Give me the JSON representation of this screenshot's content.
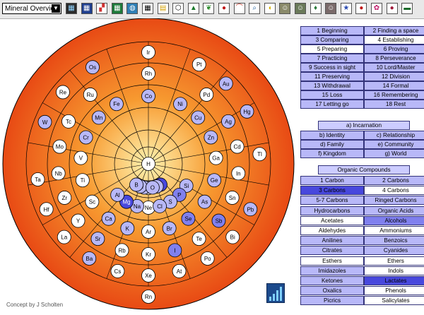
{
  "toolbar": {
    "dropdown_value": "Mineral Overview",
    "icons": [
      {
        "name": "grid-dark-icon",
        "bg": "#2b2b2b",
        "fg": "#8fd4ff",
        "g": "▦"
      },
      {
        "name": "grid-blue-icon",
        "bg": "#1f3f8f",
        "fg": "#ffffff",
        "g": "▦"
      },
      {
        "name": "color-squares-icon",
        "bg": "#ffffff",
        "fg": "#d03030",
        "g": "▞"
      },
      {
        "name": "grid-green-icon",
        "bg": "#1d7a3a",
        "fg": "#ffffff",
        "g": "▦"
      },
      {
        "name": "globe-icon",
        "bg": "#2f7fb5",
        "fg": "#ffffff",
        "g": "◍"
      },
      {
        "name": "table-grid-icon",
        "bg": "#ffffff",
        "fg": "#000000",
        "g": "▦"
      },
      {
        "name": "blocks-icon",
        "bg": "#ffffff",
        "fg": "#d4a000",
        "g": "▤"
      },
      {
        "name": "hexagon-icon",
        "bg": "#ffffff",
        "fg": "#000000",
        "g": "⬡"
      },
      {
        "name": "pine-tree-icon",
        "bg": "#ffffff",
        "fg": "#1a7a2a",
        "g": "▲"
      },
      {
        "name": "leaf-icon",
        "bg": "#ffffff",
        "fg": "#2a8a2a",
        "g": "❦"
      },
      {
        "name": "cherries-icon",
        "bg": "#ffffff",
        "fg": "#c01a1a",
        "g": "●"
      },
      {
        "name": "mushroom-icon",
        "bg": "#ffffff",
        "fg": "#c83a2a",
        "g": "⌒"
      },
      {
        "name": "magnifier-icon",
        "bg": "#ffffff",
        "fg": "#1a5a9a",
        "g": "⌕"
      },
      {
        "name": "duck-icon",
        "bg": "#ffffff",
        "fg": "#d4b000",
        "g": "◖"
      },
      {
        "name": "portrait-a-icon",
        "bg": "#8a8a6a",
        "fg": "#ffffff",
        "g": "☺"
      },
      {
        "name": "portrait-b-icon",
        "bg": "#6a7a5a",
        "fg": "#ffffff",
        "g": "☺"
      },
      {
        "name": "drop-icon",
        "bg": "#ffffff",
        "fg": "#2a7a3a",
        "g": "♦"
      },
      {
        "name": "portrait-c-icon",
        "bg": "#7a6a6a",
        "fg": "#ffffff",
        "g": "☺"
      },
      {
        "name": "star-icon",
        "bg": "#ffffff",
        "fg": "#2a4ab0",
        "g": "★"
      },
      {
        "name": "apple-icon",
        "bg": "#ffffff",
        "fg": "#c01a1a",
        "g": "●"
      },
      {
        "name": "flower-icon",
        "bg": "#ffffff",
        "fg": "#c01a6a",
        "g": "✿"
      },
      {
        "name": "berry-icon",
        "bg": "#ffffff",
        "fg": "#a01a3a",
        "g": "●"
      },
      {
        "name": "car-icon",
        "bg": "#ffffff",
        "fg": "#1a6a2a",
        "g": "▬"
      }
    ]
  },
  "wheel": {
    "colors": {
      "outer": "#e84a14",
      "mid": "#f79a30",
      "center": "#fff3b0",
      "ring_line": "#000000",
      "chip_white": "#ffffff",
      "chip_light": "#b8b8f8",
      "chip_mid": "#8080ee",
      "chip_dark": "#4848dd"
    },
    "elements": [
      {
        "s": "H",
        "r": 0,
        "a": 0,
        "t": "w"
      },
      {
        "s": "He",
        "r": 1,
        "a": 0,
        "t": "w"
      },
      {
        "s": "Li",
        "r": 1,
        "a": 10,
        "t": "l"
      },
      {
        "s": "Be",
        "r": 1,
        "a": 20,
        "t": "l"
      },
      {
        "s": "B",
        "r": 1,
        "a": 30,
        "t": "l"
      },
      {
        "s": "C",
        "r": 1,
        "a": 330,
        "t": "d"
      },
      {
        "s": "N",
        "r": 1,
        "a": 340,
        "t": "l"
      },
      {
        "s": "O",
        "r": 1,
        "a": 350,
        "t": "l"
      },
      {
        "s": "Ne",
        "r": 2,
        "a": 0,
        "t": "w"
      },
      {
        "s": "Na",
        "r": 2,
        "a": 15,
        "t": "l"
      },
      {
        "s": "Mg",
        "r": 2,
        "a": 30,
        "t": "d"
      },
      {
        "s": "Al",
        "r": 2,
        "a": 45,
        "t": "l"
      },
      {
        "s": "Si",
        "r": 2,
        "a": 300,
        "t": "l"
      },
      {
        "s": "P",
        "r": 2,
        "a": 315,
        "t": "m"
      },
      {
        "s": "S",
        "r": 2,
        "a": 330,
        "t": "l"
      },
      {
        "s": "Cl",
        "r": 2,
        "a": 345,
        "t": "l"
      },
      {
        "s": "Ar",
        "r": 3,
        "a": 0,
        "t": "w"
      },
      {
        "s": "K",
        "r": 3,
        "a": 18,
        "t": "l"
      },
      {
        "s": "Ca",
        "r": 3,
        "a": 36,
        "t": "l"
      },
      {
        "s": "Sc",
        "r": 3,
        "a": 56,
        "t": "w"
      },
      {
        "s": "Ti",
        "r": 3,
        "a": 76,
        "t": "w"
      },
      {
        "s": "V",
        "r": 3,
        "a": 95,
        "t": "w"
      },
      {
        "s": "Cr",
        "r": 3,
        "a": 113,
        "t": "l"
      },
      {
        "s": "Mn",
        "r": 3,
        "a": 133,
        "t": "l"
      },
      {
        "s": "Fe",
        "r": 3,
        "a": 152,
        "t": "l"
      },
      {
        "s": "Co",
        "r": 3,
        "a": 180,
        "t": "l"
      },
      {
        "s": "Ni",
        "r": 3,
        "a": 208,
        "t": "l"
      },
      {
        "s": "Cu",
        "r": 3,
        "a": 227,
        "t": "l"
      },
      {
        "s": "Zn",
        "r": 3,
        "a": 247,
        "t": "l"
      },
      {
        "s": "Ga",
        "r": 3,
        "a": 265,
        "t": "w"
      },
      {
        "s": "Ge",
        "r": 3,
        "a": 284,
        "t": "l"
      },
      {
        "s": "As",
        "r": 3,
        "a": 304,
        "t": "l"
      },
      {
        "s": "Se",
        "r": 3,
        "a": 324,
        "t": "m"
      },
      {
        "s": "Br",
        "r": 3,
        "a": 342,
        "t": "l"
      },
      {
        "s": "Kr",
        "r": 4,
        "a": 0,
        "t": "w"
      },
      {
        "s": "Rb",
        "r": 4,
        "a": 17,
        "t": "w"
      },
      {
        "s": "Sr",
        "r": 4,
        "a": 34,
        "t": "l"
      },
      {
        "s": "Y",
        "r": 4,
        "a": 51,
        "t": "w"
      },
      {
        "s": "Zr",
        "r": 4,
        "a": 68,
        "t": "w"
      },
      {
        "s": "Nb",
        "r": 4,
        "a": 84,
        "t": "w"
      },
      {
        "s": "Mo",
        "r": 4,
        "a": 101,
        "t": "w"
      },
      {
        "s": "Tc",
        "r": 4,
        "a": 118,
        "t": "w"
      },
      {
        "s": "Ru",
        "r": 4,
        "a": 140,
        "t": "w"
      },
      {
        "s": "Rh",
        "r": 4,
        "a": 180,
        "t": "w"
      },
      {
        "s": "Pd",
        "r": 4,
        "a": 220,
        "t": "w"
      },
      {
        "s": "Ag",
        "r": 4,
        "a": 242,
        "t": "l"
      },
      {
        "s": "Cd",
        "r": 4,
        "a": 259,
        "t": "w"
      },
      {
        "s": "In",
        "r": 4,
        "a": 276,
        "t": "w"
      },
      {
        "s": "Sn",
        "r": 4,
        "a": 292,
        "t": "w"
      },
      {
        "s": "Sb",
        "r": 4,
        "a": 309,
        "t": "m"
      },
      {
        "s": "Te",
        "r": 4,
        "a": 326,
        "t": "w"
      },
      {
        "s": "I",
        "r": 4,
        "a": 343,
        "t": "m"
      },
      {
        "s": "Xe",
        "r": 5,
        "a": 0,
        "t": "w"
      },
      {
        "s": "Cs",
        "r": 5,
        "a": 16,
        "t": "w"
      },
      {
        "s": "Ba",
        "r": 5,
        "a": 32,
        "t": "l"
      },
      {
        "s": "La",
        "r": 5,
        "a": 49,
        "t": "w"
      },
      {
        "s": "Hf",
        "r": 5,
        "a": 66,
        "t": "w"
      },
      {
        "s": "Ta",
        "r": 5,
        "a": 82,
        "t": "w"
      },
      {
        "s": "W",
        "r": 5,
        "a": 112,
        "t": "l"
      },
      {
        "s": "Re",
        "r": 5,
        "a": 130,
        "t": "w"
      },
      {
        "s": "Os",
        "r": 5,
        "a": 150,
        "t": "l"
      },
      {
        "s": "Ir",
        "r": 5,
        "a": 180,
        "t": "w"
      },
      {
        "s": "Pt",
        "r": 5,
        "a": 207,
        "t": "w"
      },
      {
        "s": "Au",
        "r": 5,
        "a": 224,
        "t": "l"
      },
      {
        "s": "Hg",
        "r": 5,
        "a": 242,
        "t": "l"
      },
      {
        "s": "Tl",
        "r": 5,
        "a": 265,
        "t": "w"
      },
      {
        "s": "Pb",
        "r": 5,
        "a": 294,
        "t": "l"
      },
      {
        "s": "Bi",
        "r": 5,
        "a": 311,
        "t": "w"
      },
      {
        "s": "Po",
        "r": 5,
        "a": 328,
        "t": "w"
      },
      {
        "s": "At",
        "r": 5,
        "a": 344,
        "t": "w"
      },
      {
        "s": "Rn",
        "r": 6,
        "a": 0,
        "t": "w"
      }
    ]
  },
  "stages": {
    "rows": [
      [
        {
          "label": "1 Beginning",
          "c": "#b8b8f8"
        },
        {
          "label": "2 Finding a space",
          "c": "#b8b8f8"
        }
      ],
      [
        {
          "label": "3 Comparing",
          "c": "#b8b8f8"
        },
        {
          "label": "4 Establishing",
          "c": "#ffffff"
        }
      ],
      [
        {
          "label": "5 Preparing",
          "c": "#ffffff"
        },
        {
          "label": "6 Proving",
          "c": "#b8b8f8"
        }
      ],
      [
        {
          "label": "7 Practicing",
          "c": "#b8b8f8"
        },
        {
          "label": "8 Perseverance",
          "c": "#b8b8f8"
        }
      ],
      [
        {
          "label": "9 Success in sight",
          "c": "#b8b8f8"
        },
        {
          "label": "10 Lord/Master",
          "c": "#b8b8f8"
        }
      ],
      [
        {
          "label": "11 Preserving",
          "c": "#b8b8f8"
        },
        {
          "label": "12 Division",
          "c": "#b8b8f8"
        }
      ],
      [
        {
          "label": "13 Withdrawal",
          "c": "#b8b8f8"
        },
        {
          "label": "14 Formal",
          "c": "#b8b8f8"
        }
      ],
      [
        {
          "label": "15 Loss",
          "c": "#b8b8f8"
        },
        {
          "label": "16 Remembering",
          "c": "#b8b8f8"
        }
      ],
      [
        {
          "label": "17 Letting go",
          "c": "#b8b8f8"
        },
        {
          "label": "18 Rest",
          "c": "#b8b8f8"
        }
      ]
    ]
  },
  "series": {
    "header": "a) Incarnation",
    "rows": [
      [
        {
          "label": "b) Identity",
          "c": "#b8b8f8"
        },
        {
          "label": "c) Relationship",
          "c": "#b8b8f8"
        }
      ],
      [
        {
          "label": "d) Family",
          "c": "#b8b8f8"
        },
        {
          "label": "e) Community",
          "c": "#b8b8f8"
        }
      ],
      [
        {
          "label": "f) Kingdom",
          "c": "#b8b8f8"
        },
        {
          "label": "g) World",
          "c": "#b8b8f8"
        }
      ]
    ]
  },
  "organic": {
    "header": "Organic Compounds",
    "rows": [
      [
        {
          "label": "1 Carbon",
          "c": "#b8b8f8"
        },
        {
          "label": "2 Carbons",
          "c": "#b8b8f8"
        }
      ],
      [
        {
          "label": "3 Carbons",
          "c": "#4848dd"
        },
        {
          "label": "4 Carbons",
          "c": "#ffffff"
        }
      ],
      [
        {
          "label": "5-7 Carbons",
          "c": "#b8b8f8"
        },
        {
          "label": "Ringed Carbons",
          "c": "#b8b8f8"
        }
      ],
      [
        {
          "label": "Hydrocarbons",
          "c": "#b8b8f8"
        },
        {
          "label": "Organic Acids",
          "c": "#b8b8f8"
        }
      ],
      [
        {
          "label": "Acetates",
          "c": "#ffffff"
        },
        {
          "label": "Alcohols",
          "c": "#8080ee"
        }
      ],
      [
        {
          "label": "Aldehydes",
          "c": "#ffffff"
        },
        {
          "label": "Ammoniums",
          "c": "#ffffff"
        }
      ],
      [
        {
          "label": "Anilines",
          "c": "#b8b8f8"
        },
        {
          "label": "Benzoics",
          "c": "#b8b8f8"
        }
      ],
      [
        {
          "label": "Citrates",
          "c": "#b8b8f8"
        },
        {
          "label": "Cyanides",
          "c": "#b8b8f8"
        }
      ],
      [
        {
          "label": "Esthers",
          "c": "#ffffff"
        },
        {
          "label": "Ethers",
          "c": "#ffffff"
        }
      ],
      [
        {
          "label": "Imidazoles",
          "c": "#b8b8f8"
        },
        {
          "label": "Indols",
          "c": "#ffffff"
        }
      ],
      [
        {
          "label": "Ketones",
          "c": "#b8b8f8"
        },
        {
          "label": "Lactates",
          "c": "#4848dd"
        }
      ],
      [
        {
          "label": "Oxalics",
          "c": "#b8b8f8"
        },
        {
          "label": "Phenols",
          "c": "#ffffff"
        }
      ],
      [
        {
          "label": "Picrics",
          "c": "#b8b8f8"
        },
        {
          "label": "Salicylates",
          "c": "#ffffff"
        }
      ]
    ]
  },
  "footer": {
    "credit": "Concept by J Scholten"
  }
}
